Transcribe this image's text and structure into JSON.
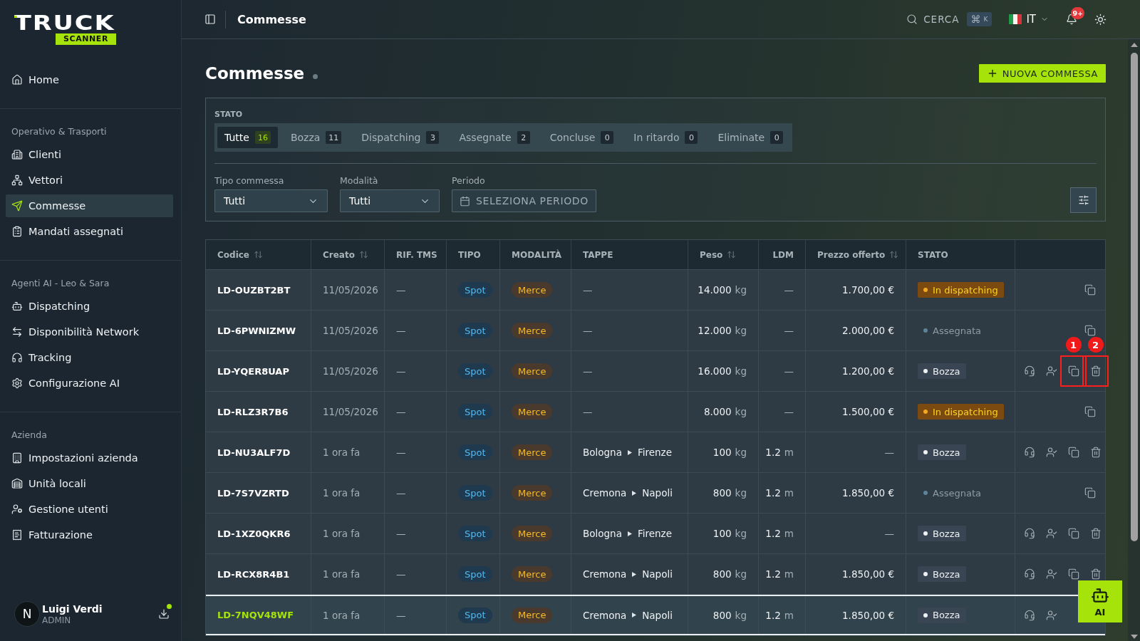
{
  "sidebar": {
    "logo": {
      "word": "TRUCK",
      "tag": "SCANNER"
    },
    "sections": [
      {
        "items": [
          {
            "label": "Home",
            "kind": "home",
            "selected": false
          }
        ]
      },
      {
        "title": "Operativo & Trasporti",
        "items": [
          {
            "label": "Clienti",
            "kind": "building",
            "selected": false
          },
          {
            "label": "Vettori",
            "kind": "network",
            "selected": false
          },
          {
            "label": "Commesse",
            "kind": "send",
            "selected": true
          },
          {
            "label": "Mandati assegnati",
            "kind": "clipboard",
            "selected": false
          }
        ]
      },
      {
        "title": "Agenti AI - Leo & Sara",
        "items": [
          {
            "label": "Dispatching",
            "kind": "bot",
            "selected": false
          },
          {
            "label": "Disponibilità Network",
            "kind": "arrows",
            "selected": false
          },
          {
            "label": "Tracking",
            "kind": "headphones",
            "selected": false
          },
          {
            "label": "Configurazione AI",
            "kind": "gear",
            "selected": false
          }
        ]
      },
      {
        "title": "Azienda",
        "items": [
          {
            "label": "Impostazioni azienda",
            "kind": "office",
            "selected": false
          },
          {
            "label": "Unità locali",
            "kind": "warehouse",
            "selected": false
          },
          {
            "label": "Gestione utenti",
            "kind": "users",
            "selected": false
          },
          {
            "label": "Fatturazione",
            "kind": "receipt",
            "selected": false
          }
        ]
      }
    ],
    "user": {
      "initial": "N",
      "name": "Luigi Verdi",
      "role": "ADMIN"
    }
  },
  "topbar": {
    "title": "Commesse",
    "search": {
      "label": "CERCA",
      "shortcut": [
        "⌘",
        "K"
      ]
    },
    "language": "IT",
    "notifications": "9+"
  },
  "page": {
    "title": "Commesse",
    "new_button": "NUOVA COMMESSA"
  },
  "filters": {
    "status_label": "STATO",
    "tabs": [
      {
        "label": "Tutte",
        "count": "16",
        "selected": true
      },
      {
        "label": "Bozza",
        "count": "11",
        "selected": false
      },
      {
        "label": "Dispatching",
        "count": "3",
        "selected": false
      },
      {
        "label": "Assegnate",
        "count": "2",
        "selected": false
      },
      {
        "label": "Concluse",
        "count": "0",
        "selected": false
      },
      {
        "label": "In ritardo",
        "count": "0",
        "selected": false
      },
      {
        "label": "Eliminate",
        "count": "0",
        "selected": false
      }
    ],
    "fields": [
      {
        "label": "Tipo commessa",
        "value": "Tutti",
        "kind": "select"
      },
      {
        "label": "Modalità",
        "value": "Tutti",
        "kind": "select"
      },
      {
        "label": "Periodo",
        "value": "SELEZIONA PERIODO",
        "kind": "date"
      }
    ]
  },
  "table": {
    "columns": [
      {
        "label": "Codice",
        "sortable": true
      },
      {
        "label": "Creato",
        "sortable": true
      },
      {
        "label": "RIF. TMS",
        "sortable": false
      },
      {
        "label": "TIPO",
        "sortable": false
      },
      {
        "label": "MODALITÀ",
        "sortable": false
      },
      {
        "label": "TAPPE",
        "sortable": false
      },
      {
        "label": "Peso",
        "sortable": true
      },
      {
        "label": "LDM",
        "sortable": false
      },
      {
        "label": "Prezzo offerto",
        "sortable": true
      },
      {
        "label": "STATO",
        "sortable": false
      }
    ],
    "rows": [
      {
        "code": "LD-OUZBT2BT",
        "created": "11/05/2026",
        "ref_tms": "—",
        "type": "Spot",
        "mode": "Merce",
        "route": [
          "—"
        ],
        "weight": {
          "value": "14.000",
          "unit": "kg"
        },
        "ldm": {
          "value": "—"
        },
        "price": {
          "amount": "1.700,00",
          "currency": "€"
        },
        "status": {
          "label": "In dispatching",
          "kind": "dispatching"
        },
        "actions": [
          {
            "kind": "copy"
          }
        ],
        "selected": false
      },
      {
        "code": "LD-6PWNIZMW",
        "created": "11/05/2026",
        "ref_tms": "—",
        "type": "Spot",
        "mode": "Merce",
        "route": [
          "—"
        ],
        "weight": {
          "value": "12.000",
          "unit": "kg"
        },
        "ldm": {
          "value": "—"
        },
        "price": {
          "amount": "2.000,00",
          "currency": "€"
        },
        "status": {
          "label": "Assegnata",
          "kind": "assigned"
        },
        "actions": [
          {
            "kind": "copy"
          }
        ],
        "selected": false
      },
      {
        "code": "LD-YQER8UAP",
        "created": "11/05/2026",
        "ref_tms": "—",
        "type": "Spot",
        "mode": "Merce",
        "route": [
          "—"
        ],
        "weight": {
          "value": "16.000",
          "unit": "kg"
        },
        "ldm": {
          "value": "—"
        },
        "price": {
          "amount": "1.200,00",
          "currency": "€"
        },
        "status": {
          "label": "Bozza",
          "kind": "draft"
        },
        "actions": [
          {
            "kind": "dispatch"
          },
          {
            "kind": "assign"
          },
          {
            "kind": "copy",
            "marker": "1"
          },
          {
            "kind": "delete",
            "marker": "2"
          }
        ],
        "selected": false
      },
      {
        "code": "LD-RLZ3R7B6",
        "created": "11/05/2026",
        "ref_tms": "—",
        "type": "Spot",
        "mode": "Merce",
        "route": [
          "—"
        ],
        "weight": {
          "value": "8.000",
          "unit": "kg"
        },
        "ldm": {
          "value": "—"
        },
        "price": {
          "amount": "1.500,00",
          "currency": "€"
        },
        "status": {
          "label": "In dispatching",
          "kind": "dispatching"
        },
        "actions": [
          {
            "kind": "copy"
          }
        ],
        "selected": false
      },
      {
        "code": "LD-NU3ALF7D",
        "created": "1 ora fa",
        "ref_tms": "—",
        "type": "Spot",
        "mode": "Merce",
        "route": [
          "Bologna",
          "Firenze"
        ],
        "weight": {
          "value": "100",
          "unit": "kg"
        },
        "ldm": {
          "value": "1.2",
          "unit": "m"
        },
        "price": {
          "amount": "—"
        },
        "status": {
          "label": "Bozza",
          "kind": "draft"
        },
        "actions": [
          {
            "kind": "dispatch"
          },
          {
            "kind": "assign"
          },
          {
            "kind": "copy"
          },
          {
            "kind": "delete"
          }
        ],
        "selected": false
      },
      {
        "code": "LD-7S7VZRTD",
        "created": "1 ora fa",
        "ref_tms": "—",
        "type": "Spot",
        "mode": "Merce",
        "route": [
          "Cremona",
          "Napoli"
        ],
        "weight": {
          "value": "800",
          "unit": "kg"
        },
        "ldm": {
          "value": "1.2",
          "unit": "m"
        },
        "price": {
          "amount": "1.850,00",
          "currency": "€"
        },
        "status": {
          "label": "Assegnata",
          "kind": "assigned"
        },
        "actions": [
          {
            "kind": "copy"
          }
        ],
        "selected": false
      },
      {
        "code": "LD-1XZ0QKR6",
        "created": "1 ora fa",
        "ref_tms": "—",
        "type": "Spot",
        "mode": "Merce",
        "route": [
          "Bologna",
          "Firenze"
        ],
        "weight": {
          "value": "100",
          "unit": "kg"
        },
        "ldm": {
          "value": "1.2",
          "unit": "m"
        },
        "price": {
          "amount": "—"
        },
        "status": {
          "label": "Bozza",
          "kind": "draft"
        },
        "actions": [
          {
            "kind": "dispatch"
          },
          {
            "kind": "assign"
          },
          {
            "kind": "copy"
          },
          {
            "kind": "delete"
          }
        ],
        "selected": false
      },
      {
        "code": "LD-RCX8R4B1",
        "created": "1 ora fa",
        "ref_tms": "—",
        "type": "Spot",
        "mode": "Merce",
        "route": [
          "Cremona",
          "Napoli"
        ],
        "weight": {
          "value": "800",
          "unit": "kg"
        },
        "ldm": {
          "value": "1.2",
          "unit": "m"
        },
        "price": {
          "amount": "1.850,00",
          "currency": "€"
        },
        "status": {
          "label": "Bozza",
          "kind": "draft"
        },
        "actions": [
          {
            "kind": "dispatch"
          },
          {
            "kind": "assign"
          },
          {
            "kind": "copy"
          },
          {
            "kind": "delete"
          }
        ],
        "selected": false
      },
      {
        "code": "LD-7NQV48WF",
        "created": "1 ora fa",
        "ref_tms": "—",
        "type": "Spot",
        "mode": "Merce",
        "route": [
          "Cremona",
          "Napoli"
        ],
        "weight": {
          "value": "800",
          "unit": "kg"
        },
        "ldm": {
          "value": "1.2",
          "unit": "m"
        },
        "price": {
          "amount": "1.850,00",
          "currency": "€"
        },
        "status": {
          "label": "Bozza",
          "kind": "draft"
        },
        "actions": [
          {
            "kind": "dispatch"
          },
          {
            "kind": "assign"
          }
        ],
        "selected": true
      }
    ]
  },
  "ai_button": {
    "label": "AI"
  }
}
